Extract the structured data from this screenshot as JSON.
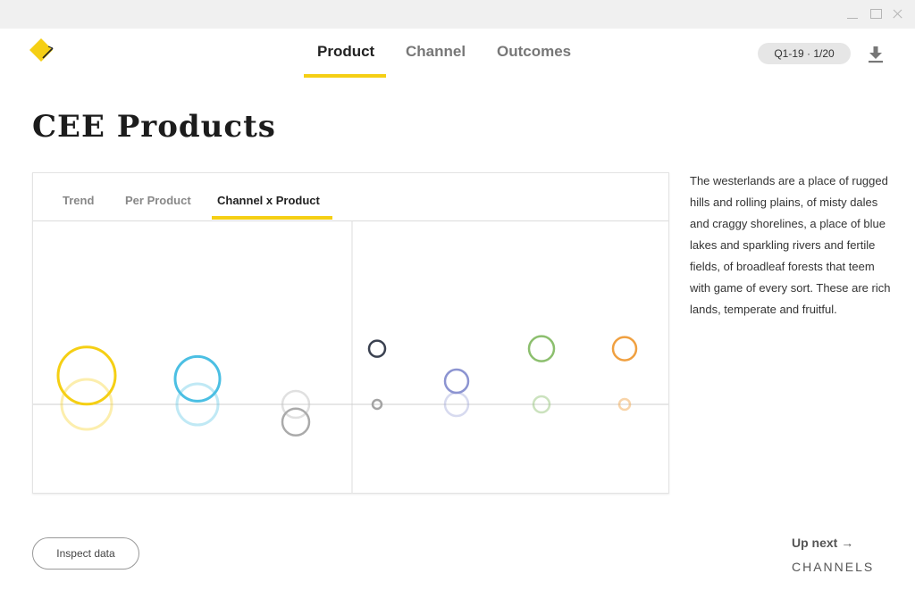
{
  "window": {
    "controls": [
      "minimize-icon",
      "maximize-icon",
      "close-icon"
    ]
  },
  "logo": {
    "icon": "diamond-logo-icon",
    "color": "#f5cf14"
  },
  "nav": {
    "tabs": [
      {
        "label": "Product",
        "active": true
      },
      {
        "label": "Channel",
        "active": false
      },
      {
        "label": "Outcomes",
        "active": false
      }
    ],
    "accent": "#f5cf14"
  },
  "header": {
    "period_label": "Q1-19 · 1/20",
    "download_icon": "download-icon"
  },
  "page": {
    "title": "CEE Products"
  },
  "panel": {
    "tabs": [
      {
        "label": "Trend",
        "active": false
      },
      {
        "label": "Per Product",
        "active": false
      },
      {
        "label": "Channel x Product",
        "active": true
      }
    ]
  },
  "description": "The westerlands are a place of rugged hills and rolling plains, of misty dales and craggy shorelines, a place of blue lakes and sparkling rivers and fertile fields, of broadleaf forests that teem with game of every sort. These are rich lands, temperate and fruitful.",
  "actions": {
    "inspect_label": "Inspect data"
  },
  "next": {
    "label": "Up next →",
    "section": "CHANNELS"
  },
  "chart_data": {
    "type": "scatter",
    "grid": false,
    "panels": [
      {
        "baseline": 0,
        "points": [
          {
            "x": 1,
            "y": 0.62,
            "size": 32,
            "color": "#f5cf14",
            "opacity": 1.0
          },
          {
            "x": 1,
            "y": 0,
            "size": 28,
            "color": "#f5cf14",
            "opacity": 0.35
          },
          {
            "x": 2,
            "y": 0.55,
            "size": 25,
            "color": "#4bbfe3",
            "opacity": 1.0
          },
          {
            "x": 2,
            "y": 0,
            "size": 23,
            "color": "#4bbfe3",
            "opacity": 0.35
          },
          {
            "x": 3,
            "y": 0,
            "size": 15,
            "color": "#bbbbbb",
            "opacity": 0.45
          },
          {
            "x": 3,
            "y": -0.38,
            "size": 15,
            "color": "#aaaaaa",
            "opacity": 1.0
          }
        ]
      },
      {
        "baseline": 0,
        "points": [
          {
            "x": 1,
            "y": 1.2,
            "size": 9,
            "color": "#3a4150",
            "opacity": 1.0
          },
          {
            "x": 1,
            "y": 0,
            "size": 5,
            "color": "#9a9a9a",
            "opacity": 0.9
          },
          {
            "x": 2,
            "y": 0.5,
            "size": 13,
            "color": "#8c94d1",
            "opacity": 1.0
          },
          {
            "x": 2,
            "y": 0,
            "size": 13,
            "color": "#8c94d1",
            "opacity": 0.35
          },
          {
            "x": 3,
            "y": 1.2,
            "size": 14,
            "color": "#8cbf6e",
            "opacity": 1.0
          },
          {
            "x": 3,
            "y": 0,
            "size": 9,
            "color": "#8cbf6e",
            "opacity": 0.45
          },
          {
            "x": 4,
            "y": 1.2,
            "size": 13,
            "color": "#f0a040",
            "opacity": 1.0
          },
          {
            "x": 4,
            "y": 0,
            "size": 6,
            "color": "#f0a040",
            "opacity": 0.45
          }
        ]
      }
    ]
  }
}
